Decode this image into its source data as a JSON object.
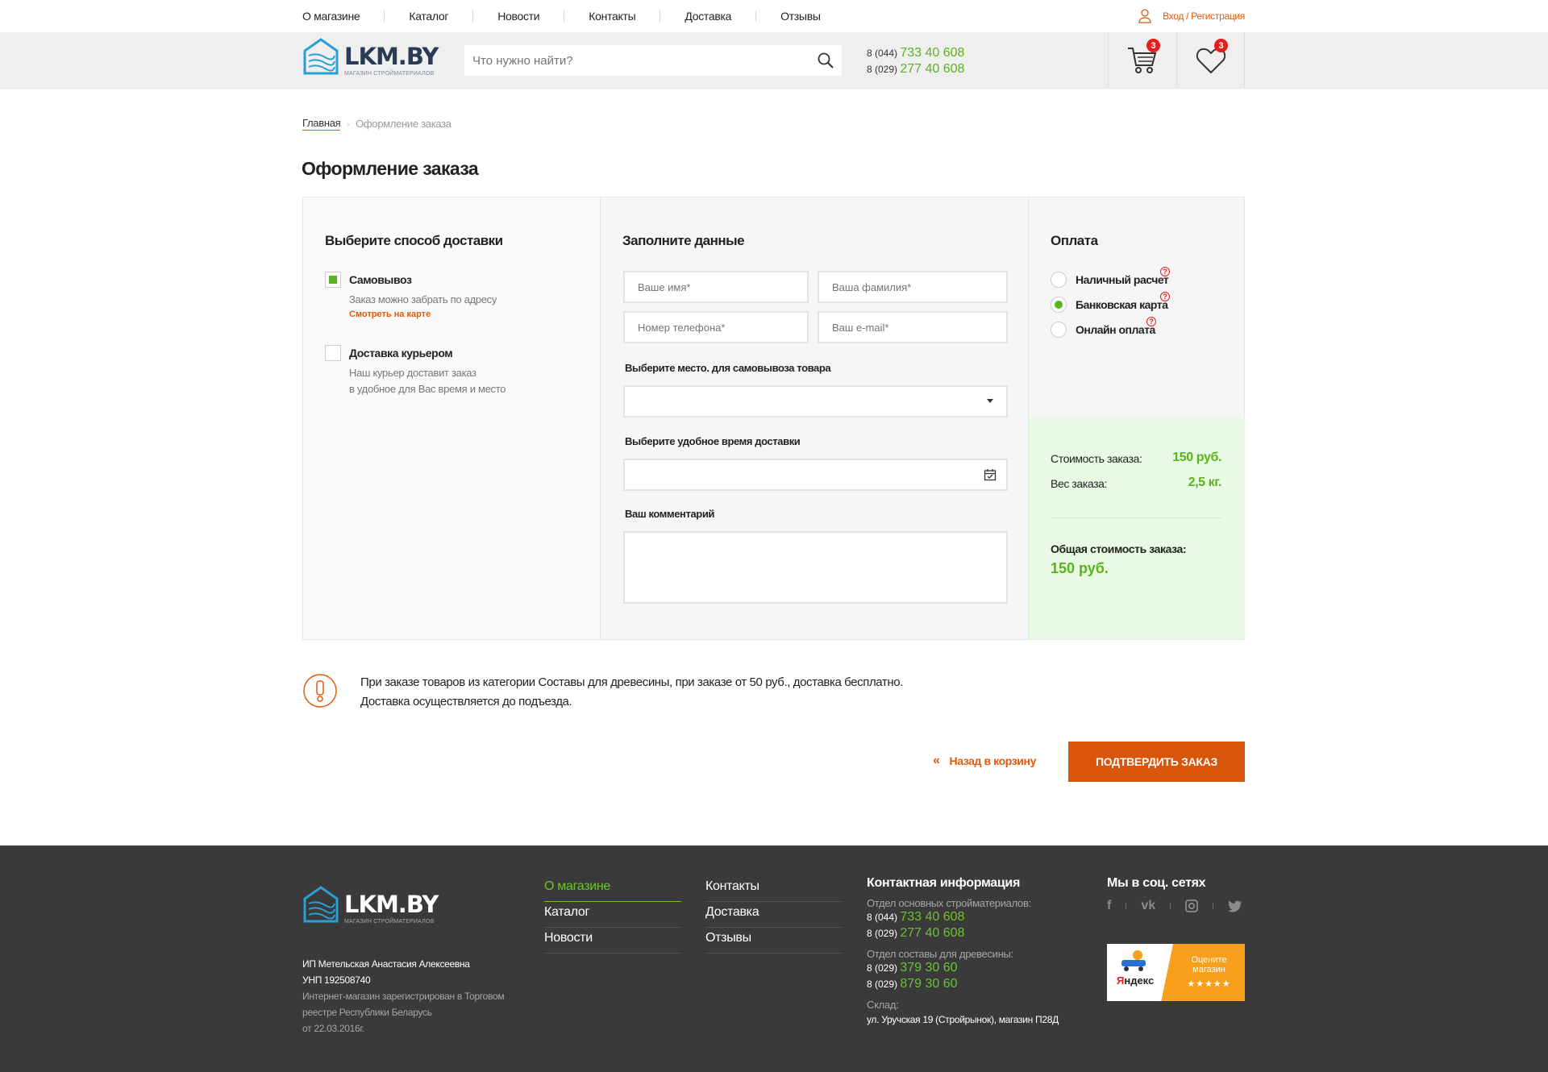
{
  "topnav": {
    "links": [
      "О магазине",
      "Каталог",
      "Новости",
      "Контакты",
      "Доставка",
      "Отзывы"
    ],
    "login": "Вход / Регистрация"
  },
  "logo": {
    "brand": "LKM.BY",
    "tagline": "МАГАЗИН СТРОЙМАТЕРИАЛОВ"
  },
  "search": {
    "placeholder": "Что нужно найти?"
  },
  "header_phones": [
    {
      "code": "8 (044)",
      "number": "733 40 608"
    },
    {
      "code": "8 (029)",
      "number": "277 40 608"
    }
  ],
  "cart": {
    "count": "3",
    "icon": "cart-icon"
  },
  "wishlist": {
    "count": "3",
    "icon": "heart-icon"
  },
  "breadcrumb": {
    "home": "Главная",
    "current": "Оформление заказа"
  },
  "page_title": "Оформление заказа",
  "delivery": {
    "heading": "Выберите способ доставки",
    "pickup": {
      "title": "Самовывоз",
      "desc": "Заказ можно забрать по адресу",
      "map_link": "Смотреть на карте",
      "checked": true
    },
    "courier": {
      "title": "Доставка курьером",
      "desc_1": "Наш курьер доставит заказ",
      "desc_2": "в удобное для Вас время и место",
      "checked": false
    }
  },
  "form": {
    "heading": "Заполните данные",
    "first_name": "Ваше имя*",
    "last_name": "Ваша фамилия*",
    "phone": "Номер телефона*",
    "email": "Ваш e-mail*",
    "pickup_place_label": "Выберите место. для самовывоза товара",
    "pickup_place_value": "",
    "time_label": "Выберите удобное время доставки",
    "time_value": "",
    "comment_label": "Ваш комментарий",
    "comment_value": ""
  },
  "payment": {
    "heading": "Оплата",
    "options": [
      {
        "label": "Наличный расчет",
        "selected": false
      },
      {
        "label": "Банковская карта",
        "selected": true
      },
      {
        "label": "Онлайн оплата",
        "selected": false
      }
    ],
    "help": "?"
  },
  "summary": {
    "cost_label": "Стоимость заказа:",
    "cost_value": "150 руб.",
    "weight_label": "Вес заказа:",
    "weight_value": "2,5 кг.",
    "total_label": "Общая стоимость заказа:",
    "total_value": "150 руб."
  },
  "notice": {
    "line1": "При заказе товаров из категории Составы для древесины, при заказе от 50 руб., доставка бесплатно.",
    "line2": "Доставка осуществляется до подъезда."
  },
  "actions": {
    "back": "Назад в корзину",
    "back_icon": "«",
    "confirm": "ПОДТВЕРДИТЬ ЗАКАЗ"
  },
  "footer": {
    "legal_name": "ИП Метельская Анастасия Алексеевна",
    "unp": "УНП 192508740",
    "reg_1": "Интернет-магазин зарегистрирован в Торговом",
    "reg_2": "реестре Республики Беларусь",
    "reg_3": "от 22.03.2016г.",
    "nav_col1": [
      "О магазине",
      "Каталог",
      "Новости"
    ],
    "nav_col2": [
      "Контакты",
      "Доставка",
      "Отзывы"
    ],
    "contacts": {
      "heading": "Контактная информация",
      "dept1": "Отдел основных стройматериалов:",
      "dept1_phones": [
        {
          "code": "8 (044)",
          "number": "733 40 608"
        },
        {
          "code": "8 (029)",
          "number": "277 40 608"
        }
      ],
      "dept2": "Отдел составы для древесины:",
      "dept2_phones": [
        {
          "code": "8 (029)",
          "number": "379 30 60"
        },
        {
          "code": "8 (029)",
          "number": "879 30 60"
        }
      ],
      "warehouse_label": "Склад:",
      "warehouse_addr": "ул. Уручская 19 (Стройрынок), магазин П28Д"
    },
    "social": {
      "heading": "Мы в соц. сетях",
      "icons": [
        "facebook-icon",
        "vk-icon",
        "instagram-icon",
        "twitter-icon"
      ]
    },
    "yandex": {
      "brand_y": "Я",
      "brand_rest": "ндекс",
      "line1": "Оцените",
      "line2": "магазин",
      "stars": "★★★★★"
    }
  },
  "colors": {
    "accent_green": "#5ab31d",
    "accent_orange": "#d8550b",
    "badge_red": "#e61e1e",
    "footer_bg": "#3a3a3a"
  }
}
